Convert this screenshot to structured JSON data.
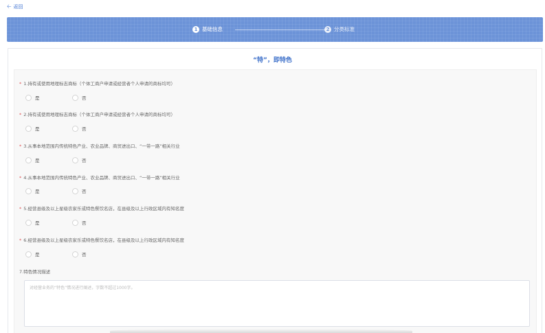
{
  "nav": {
    "back_label": "返回"
  },
  "steps": [
    {
      "num": "1",
      "label": "基础信息"
    },
    {
      "num": "2",
      "label": "分类标准"
    }
  ],
  "section": {
    "title": "“特”，即特色"
  },
  "questions": [
    {
      "label": "1.持有或使用地理标志商标（个体工商户申请或经营者个人申请的商标均可）",
      "required": "*",
      "yes": "是",
      "no": "否"
    },
    {
      "label": "2.持有或使用地理标志商标（个体工商户申请或经营者个人申请的商标均可）",
      "required": "*",
      "yes": "是",
      "no": "否"
    },
    {
      "label": "3.从事本地范围内传统特色产业、农业品牌、商贸进出口、“一带一路”相关行业",
      "required": "*",
      "yes": "是",
      "no": "否"
    },
    {
      "label": "4.从事本地范围内传统特色产业、农业品牌、商贸进出口、“一带一路”相关行业",
      "required": "*",
      "yes": "是",
      "no": "否"
    },
    {
      "label": "5.经营县级及以上星级农家乐或特色餐饮名店，在县级及以上行政区域内有知名度",
      "required": "*",
      "yes": "是",
      "no": "否"
    },
    {
      "label": "6.经营县级及以上星级农家乐或特色餐饮名店，在县级及以上行政区域内有知名度",
      "required": "*",
      "yes": "是",
      "no": "否"
    }
  ],
  "description": {
    "label": "7.特色情况描述",
    "placeholder": "对经营业务的“特色”情况进行阐述，字数不超过1000字。",
    "value": ""
  },
  "colors": {
    "accent": "#3c6fc9",
    "banner": "#6c93d8",
    "required": "#e05555"
  },
  "icons": {
    "back": "arrow-left-icon",
    "radio": "radio-unchecked-icon"
  }
}
